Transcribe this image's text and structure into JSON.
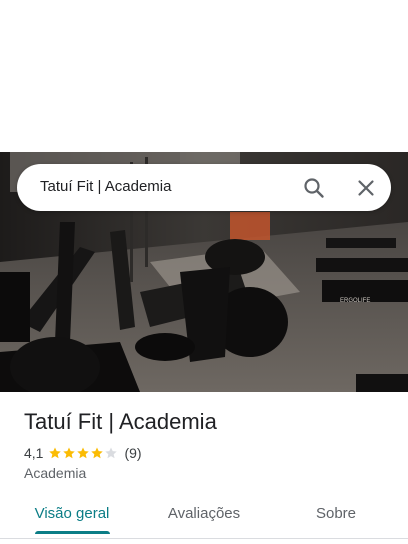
{
  "search": {
    "value": "Tatuí Fit | Academia"
  },
  "place": {
    "title": "Tatuí Fit | Academia",
    "rating": "4,1",
    "stars": 4,
    "star_max": 5,
    "review_count": "(9)",
    "category": "Academia"
  },
  "hero": {
    "brand_label": "ERGOLIFE"
  },
  "tabs": [
    {
      "label": "Visão geral",
      "active": true
    },
    {
      "label": "Avaliações",
      "active": false
    },
    {
      "label": "Sobre",
      "active": false
    }
  ],
  "colors": {
    "accent": "#0b7d86",
    "star": "#fbbc04",
    "star_empty": "#dadce0"
  }
}
